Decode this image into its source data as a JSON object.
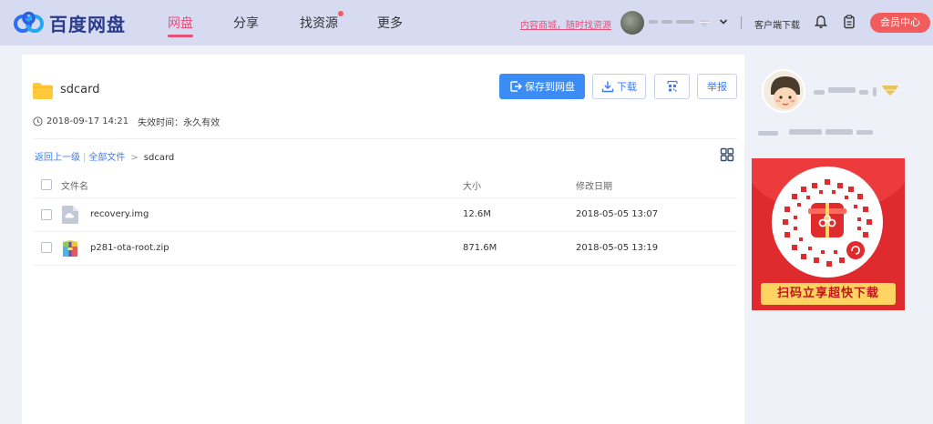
{
  "header": {
    "logo_text": "百度网盘",
    "nav": [
      {
        "label": "网盘",
        "active": true
      },
      {
        "label": "分享",
        "active": false
      },
      {
        "label": "找资源",
        "active": false,
        "dot": true
      },
      {
        "label": "更多",
        "active": false
      }
    ],
    "promo_link": "内容商城，随时找资源",
    "client_download": "客户端下载",
    "member_button": "会员中心",
    "icons": [
      "baidu-cloud-logo",
      "vip-diamond-icon",
      "chevron-down-icon",
      "bell-icon",
      "clipboard-icon"
    ]
  },
  "share": {
    "title": "sdcard",
    "created": "2018-09-17 14:21",
    "expire_label": "失效时间：",
    "expire_value": "永久有效",
    "actions": {
      "save": "保存到网盘",
      "download": "下载",
      "report": "举报"
    }
  },
  "breadcrumb": {
    "back": "返回上一级",
    "all": "全部文件",
    "separator": ">",
    "current": "sdcard"
  },
  "table": {
    "headers": {
      "name": "文件名",
      "size": "大小",
      "modified": "修改日期"
    },
    "rows": [
      {
        "name": "recovery.img",
        "size": "12.6M",
        "modified": "2018-05-05 13:07",
        "icon": "disk-image-file-icon"
      },
      {
        "name": "p281-ota-root.zip",
        "size": "871.6M",
        "modified": "2018-05-05 13:19",
        "icon": "zip-archive-file-icon"
      }
    ]
  },
  "ad": {
    "banner": "扫码立享超快下载"
  },
  "colors": {
    "accent_pink": "#e8507a",
    "primary_blue": "#3c8cf5",
    "member_red": "#f25c5c",
    "ad_red": "#e02b2e",
    "ad_yellow": "#ffd460"
  }
}
